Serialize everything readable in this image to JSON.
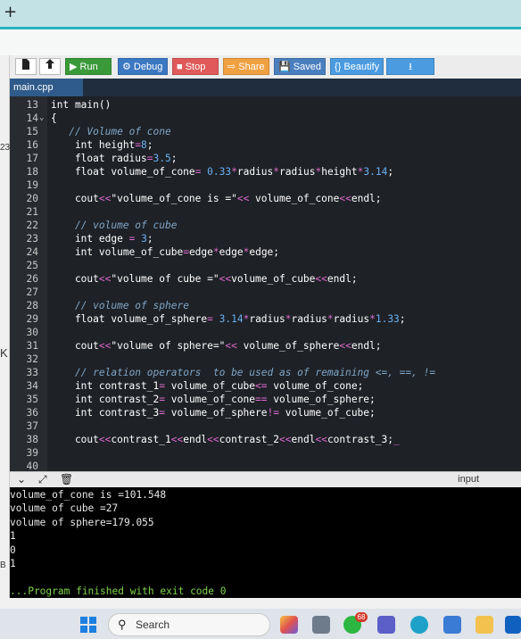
{
  "browser": {
    "new_tab_glyph": "+"
  },
  "left_strip": {
    "labels": [
      "23",
      "K",
      "B"
    ]
  },
  "toolbar": {
    "buttons": [
      {
        "id": "run",
        "label": "▶ Run",
        "color": "#3a9a3a"
      },
      {
        "id": "debug",
        "label": "⚙ Debug",
        "color": "#3b78c2"
      },
      {
        "id": "stop",
        "label": "■ Stop",
        "color": "#e05a5a"
      },
      {
        "id": "share",
        "label": "⇨ Share",
        "color": "#f0a040"
      },
      {
        "id": "saved",
        "label": "💾 Saved",
        "color": "#4a7fbf"
      },
      {
        "id": "beautify",
        "label": "{} Beautify",
        "color": "#4a9be0"
      },
      {
        "id": "download",
        "label": "⭳",
        "color": "#4a9be0"
      }
    ]
  },
  "file_tab": {
    "name": "main.cpp"
  },
  "editor": {
    "lines": [
      {
        "n": "13",
        "html": "int main()"
      },
      {
        "n": "14",
        "html": "{",
        "fold": true
      },
      {
        "n": "15",
        "html": "   <span class='cm'>// Volume of cone</span>"
      },
      {
        "n": "16",
        "html": "    int height<span class='op'>=</span><span class='num'>8</span>;"
      },
      {
        "n": "17",
        "html": "    float radius<span class='op'>=</span><span class='num'>3.5</span>;"
      },
      {
        "n": "18",
        "html": "    float volume_of_cone<span class='op'>=</span> <span class='num'>0.33</span><span class='op'>*</span>radius<span class='op'>*</span>radius<span class='op'>*</span>height<span class='op'>*</span><span class='num'>3.14</span>;"
      },
      {
        "n": "19",
        "html": ""
      },
      {
        "n": "20",
        "html": "    cout<span class='op'>&lt;&lt;</span>\"volume_of_cone is =\"<span class='op'>&lt;&lt;</span> volume_of_cone<span class='op'>&lt;&lt;</span>endl;"
      },
      {
        "n": "21",
        "html": ""
      },
      {
        "n": "22",
        "html": "    <span class='cm'>// volume of cube</span>"
      },
      {
        "n": "23",
        "html": "    int edge <span class='op'>=</span> <span class='num'>3</span>;"
      },
      {
        "n": "24",
        "html": "    int volume_of_cube<span class='op'>=</span>edge<span class='op'>*</span>edge<span class='op'>*</span>edge;"
      },
      {
        "n": "25",
        "html": ""
      },
      {
        "n": "26",
        "html": "    cout<span class='op'>&lt;&lt;</span>\"volume of cube =\"<span class='op'>&lt;&lt;</span>volume_of_cube<span class='op'>&lt;&lt;</span>endl;"
      },
      {
        "n": "27",
        "html": ""
      },
      {
        "n": "28",
        "html": "    <span class='cm'>// volume of sphere</span>"
      },
      {
        "n": "29",
        "html": "    float volume_of_sphere<span class='op'>=</span> <span class='num'>3.14</span><span class='op'>*</span>radius<span class='op'>*</span>radius<span class='op'>*</span>radius<span class='op'>*</span><span class='num'>1.33</span>;"
      },
      {
        "n": "30",
        "html": ""
      },
      {
        "n": "31",
        "html": "    cout<span class='op'>&lt;&lt;</span>\"volume of sphere=\"<span class='op'>&lt;&lt;</span> volume_of_sphere<span class='op'>&lt;&lt;</span>endl;"
      },
      {
        "n": "32",
        "html": ""
      },
      {
        "n": "33",
        "html": "    <span class='cm'>// relation operators  to be used as of remaining &lt;=, ==, !=</span>"
      },
      {
        "n": "34",
        "html": "    int contrast_1<span class='op'>=</span> volume_of_cube<span class='op'>&lt;=</span> volume_of_cone;"
      },
      {
        "n": "35",
        "html": "    int contrast_2<span class='op'>=</span> volume_of_cone<span class='op'>==</span> volume_of_sphere;"
      },
      {
        "n": "36",
        "html": "    int contrast_3<span class='op'>=</span> volume_of_sphere<span class='op'>!=</span> volume_of_cube;"
      },
      {
        "n": "37",
        "html": ""
      },
      {
        "n": "38",
        "html": "    cout<span class='op'>&lt;&lt;</span>contrast_1<span class='op'>&lt;&lt;</span>endl<span class='op'>&lt;&lt;</span>contrast_2<span class='op'>&lt;&lt;</span>endl<span class='op'>&lt;&lt;</span>contrast_3;<span class='op'>_</span>"
      },
      {
        "n": "39",
        "html": ""
      },
      {
        "n": "40",
        "html": ""
      }
    ]
  },
  "output_panel": {
    "input_label": "input"
  },
  "console": {
    "lines": [
      {
        "text": "volume_of_cone is =101.548",
        "green": false
      },
      {
        "text": "volume of cube =27",
        "green": false
      },
      {
        "text": "volume of sphere=179.055",
        "green": false
      },
      {
        "text": "1",
        "green": false
      },
      {
        "text": "0",
        "green": false
      },
      {
        "text": "1",
        "green": false
      },
      {
        "text": "",
        "green": false
      },
      {
        "text": "...Program finished with exit code 0",
        "green": true
      }
    ]
  },
  "taskbar": {
    "search_label": "Search",
    "notification_count": "68"
  }
}
